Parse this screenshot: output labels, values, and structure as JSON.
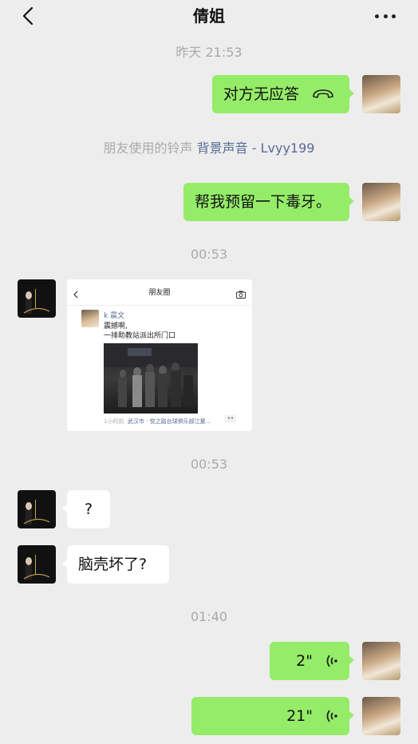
{
  "header": {
    "title": "倩姐"
  },
  "timestamps": [
    "昨天 21:53",
    "00:53",
    "00:53",
    "01:40"
  ],
  "messages": {
    "call": {
      "text": "对方无应答"
    },
    "ringtone": {
      "prefix": "朋友使用的铃声",
      "link": "背景声音 - Lvyy199"
    },
    "venom": {
      "text": "帮我预留一下毒牙。"
    },
    "moments_card": {
      "page_title": "朋友圈",
      "user": "k 晨文",
      "line1": "震撼啊,",
      "line2": "一排助教站派出所门口",
      "time": "1小时前",
      "location": "武汉市 · 悦之路台球俱乐部江夏..."
    },
    "question": {
      "text": "?"
    },
    "brain": {
      "text": "脑壳坏了?"
    },
    "voice1": {
      "duration": "2\""
    },
    "voice2": {
      "duration": "21\""
    }
  },
  "colors": {
    "self_bubble": "#95ec69",
    "other_bubble": "#ffffff",
    "background": "#ededed",
    "link": "#576b95"
  },
  "icons": [
    "back-arrow-icon",
    "more-icon",
    "hangup-phone-icon",
    "voice-wave-icon",
    "camera-icon"
  ]
}
